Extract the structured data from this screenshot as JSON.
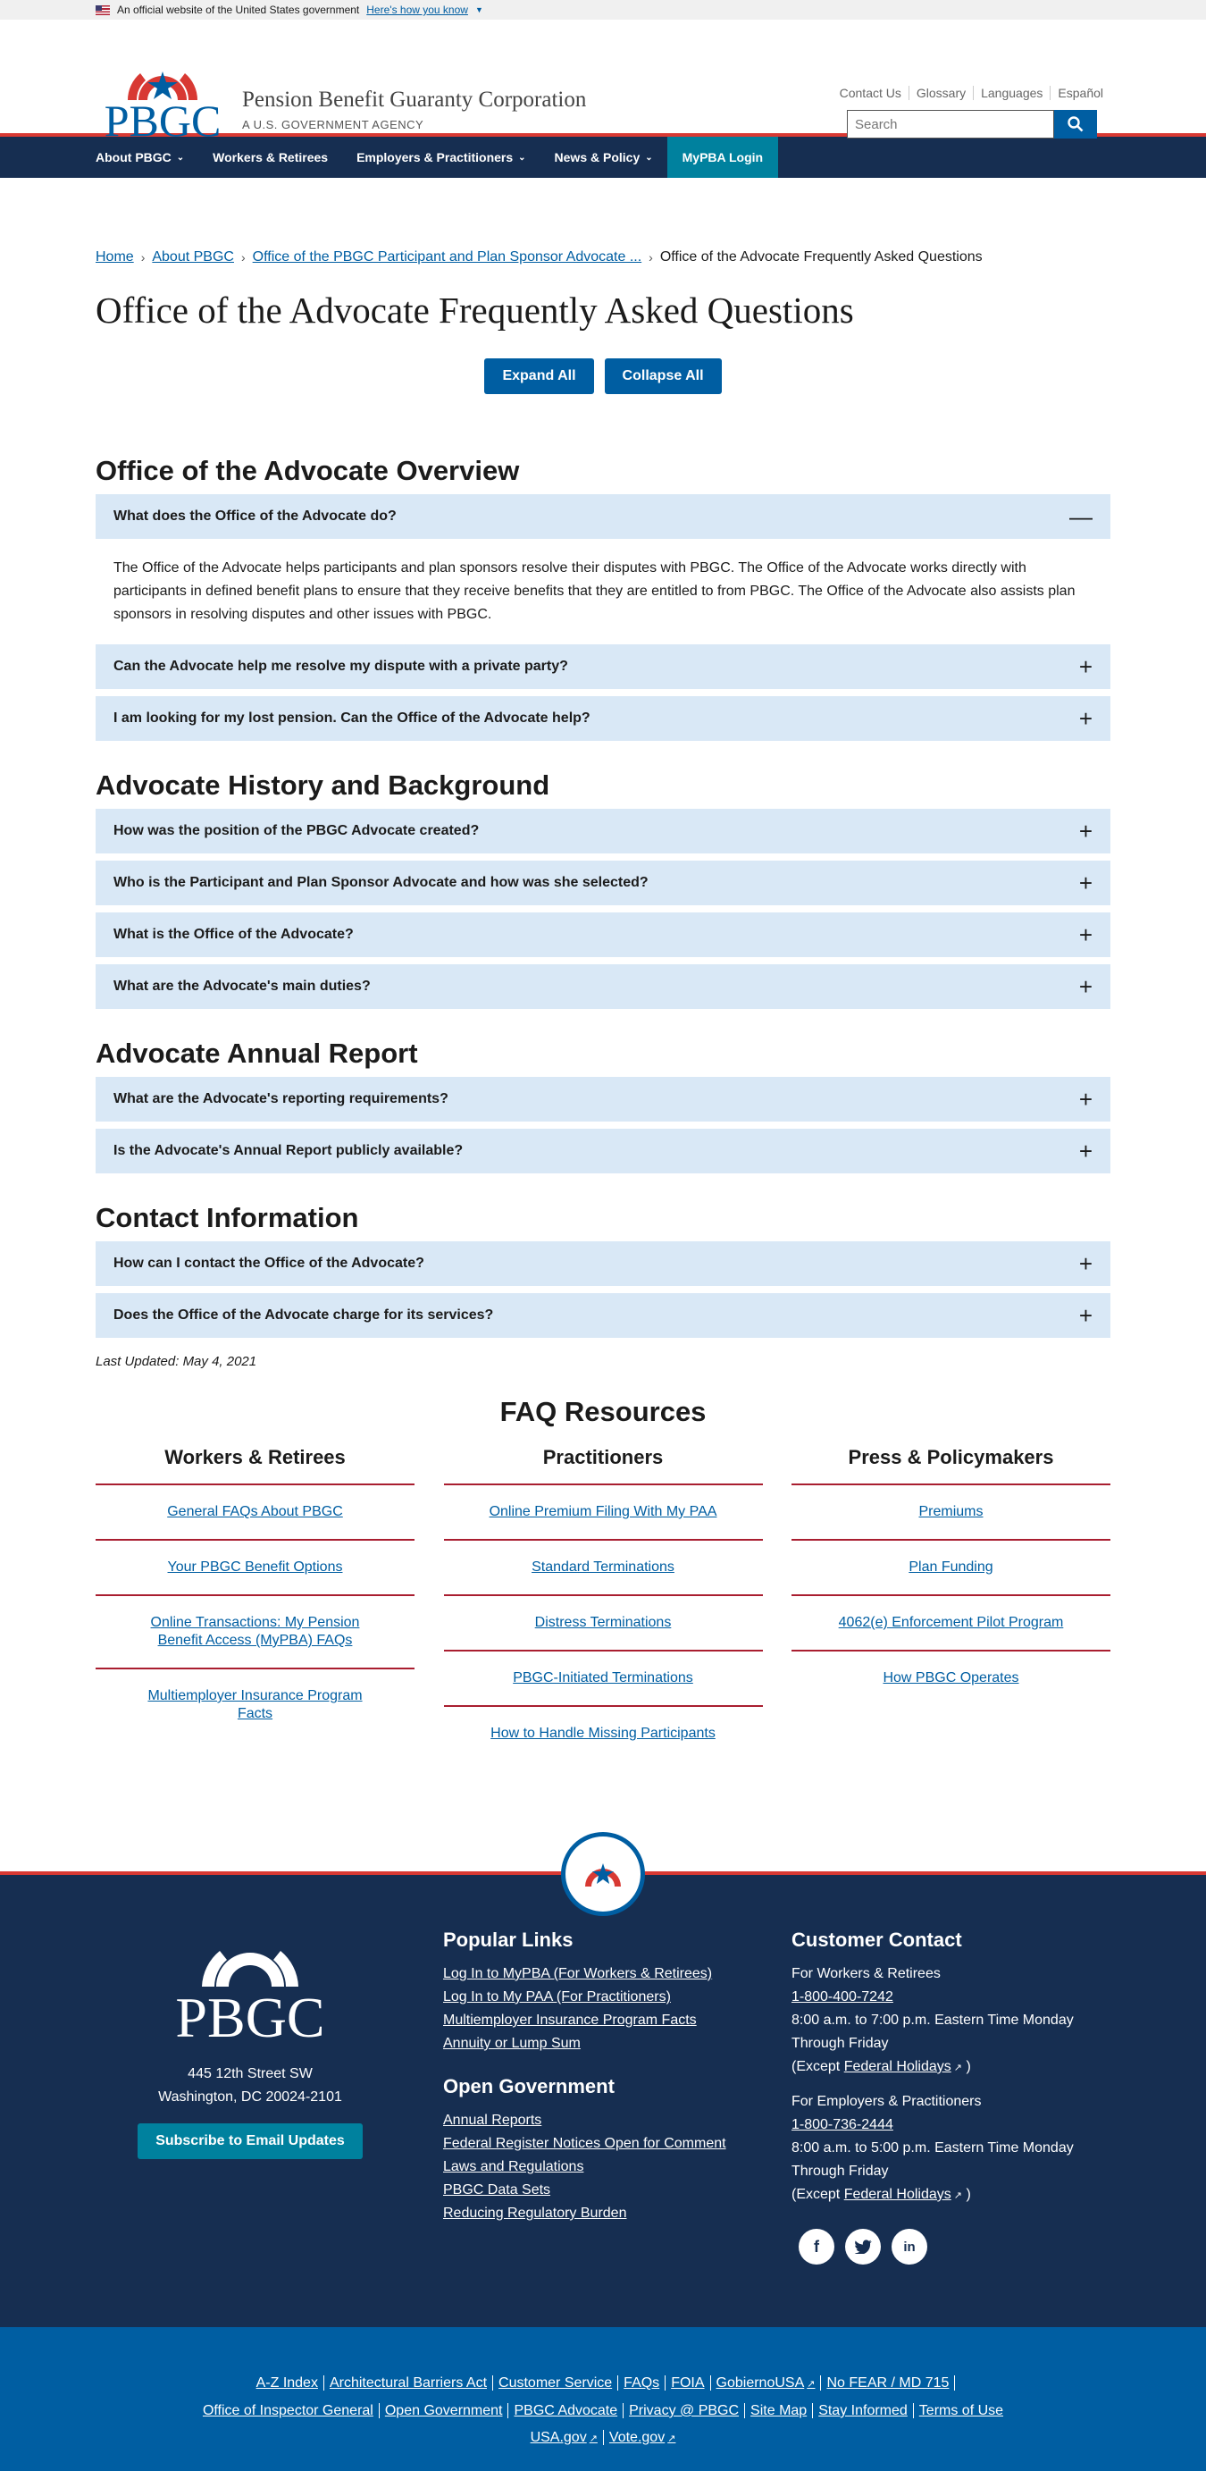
{
  "gov_banner": {
    "text": "An official website of the United States government",
    "link": "Here's how you know"
  },
  "header": {
    "logo_text": "PBGC",
    "org_name": "Pension Benefit Guaranty Corporation",
    "org_sub": "A U.S. GOVERNMENT AGENCY",
    "util_links": [
      "Contact Us",
      "Glossary",
      "Languages",
      "Español"
    ],
    "search_placeholder": "Search"
  },
  "nav": {
    "items": [
      "About PBGC",
      "Workers & Retirees",
      "Employers & Practitioners",
      "News & Policy"
    ],
    "login": "MyPBA Login"
  },
  "breadcrumb": [
    "Home",
    "About PBGC",
    "Office of the PBGC Participant and Plan Sponsor Advocate ...",
    "Office of the Advocate Frequently Asked Questions"
  ],
  "page_title": "Office of the Advocate Frequently Asked Questions",
  "buttons": {
    "expand": "Expand All",
    "collapse": "Collapse All"
  },
  "sections": [
    {
      "title": "Office of the Advocate Overview",
      "items": [
        {
          "q": "What does the Office of the Advocate do?",
          "open": true,
          "a": "The Office of the Advocate helps participants and plan sponsors resolve their disputes with PBGC. The Office of the Advocate works directly with participants in defined benefit plans to ensure that they receive benefits that they are entitled to from PBGC. The Office of the Advocate also assists plan sponsors in resolving disputes and other issues with PBGC."
        },
        {
          "q": "Can the Advocate help me resolve my dispute with a private party?"
        },
        {
          "q": "I am looking for my lost pension. Can the Office of the Advocate help?"
        }
      ]
    },
    {
      "title": "Advocate History and Background",
      "items": [
        {
          "q": "How was the position of the PBGC Advocate created?"
        },
        {
          "q": "Who is the Participant and Plan Sponsor Advocate and how was she selected?"
        },
        {
          "q": "What is the Office of the Advocate?"
        },
        {
          "q": "What are the Advocate's main duties?"
        }
      ]
    },
    {
      "title": "Advocate Annual Report",
      "items": [
        {
          "q": "What are the Advocate's reporting requirements?"
        },
        {
          "q": "Is the Advocate's Annual Report publicly available?"
        }
      ]
    },
    {
      "title": "Contact Information",
      "items": [
        {
          "q": "How can I contact the Office of the Advocate?"
        },
        {
          "q": "Does the Office of the Advocate charge for its services?"
        }
      ]
    }
  ],
  "last_updated": "Last Updated: May 4, 2021",
  "faq_resources": {
    "title": "FAQ Resources",
    "columns": [
      {
        "title": "Workers & Retirees",
        "links": [
          "General FAQs About PBGC",
          "Your PBGC Benefit Options",
          "Online Transactions: My Pension Benefit Access (MyPBA) FAQs",
          "Multiemployer Insurance Program Facts"
        ]
      },
      {
        "title": "Practitioners",
        "links": [
          "Online Premium Filing With My PAA",
          "Standard Terminations",
          "Distress Terminations",
          "PBGC-Initiated Terminations",
          "How to Handle Missing Participants"
        ]
      },
      {
        "title": "Press & Policymakers",
        "links": [
          "Premiums",
          "Plan Funding",
          "4062(e) Enforcement Pilot Program",
          "How PBGC Operates"
        ]
      }
    ]
  },
  "footer": {
    "logo_text": "PBGC",
    "address1": "445 12th Street SW",
    "address2": "Washington, DC 20024-2101",
    "subscribe": "Subscribe to Email Updates",
    "popular": {
      "title": "Popular Links",
      "links": [
        "Log In to MyPBA (For Workers & Retirees)",
        "Log In to My PAA (For Practitioners)",
        "Multiemployer Insurance Program Facts",
        "Annuity or Lump Sum"
      ]
    },
    "open_gov": {
      "title": "Open Government",
      "links": [
        "Annual Reports",
        "Federal Register Notices Open for Comment",
        "Laws and Regulations",
        "PBGC Data Sets",
        "Reducing Regulatory Burden"
      ]
    },
    "contact": {
      "title": "Customer Contact",
      "g1_label": "For Workers & Retirees",
      "g1_phone": "1-800-400-7242",
      "g1_hours": "8:00 a.m. to 7:00 p.m. Eastern Time Monday Through Friday",
      "g2_label": "For Employers & Practitioners",
      "g2_phone": "1-800-736-2444",
      "g2_hours": "8:00 a.m. to 5:00 p.m. Eastern Time Monday Through Friday",
      "except": "(Except",
      "holidays": "Federal Holidays",
      "close": ")"
    },
    "social": [
      "facebook-icon",
      "twitter-icon",
      "linkedin-icon"
    ]
  },
  "subfooter": {
    "line1": [
      "A-Z Index",
      "Architectural Barriers Act",
      "Customer Service",
      "FAQs",
      "FOIA",
      "GobiernoUSA",
      "No FEAR / MD 715"
    ],
    "line2": [
      "Office of Inspector General",
      "Open Government",
      "PBGC Advocate",
      "Privacy @ PBGC",
      "Site Map",
      "Stay Informed",
      "Terms of Use"
    ],
    "line3": [
      "USA.gov",
      "Vote.gov"
    ]
  },
  "colors": {
    "navy": "#162e51",
    "blue": "#005ea2",
    "teal": "#00819e",
    "red": "#d83933",
    "accordion": "#d9e8f6"
  }
}
